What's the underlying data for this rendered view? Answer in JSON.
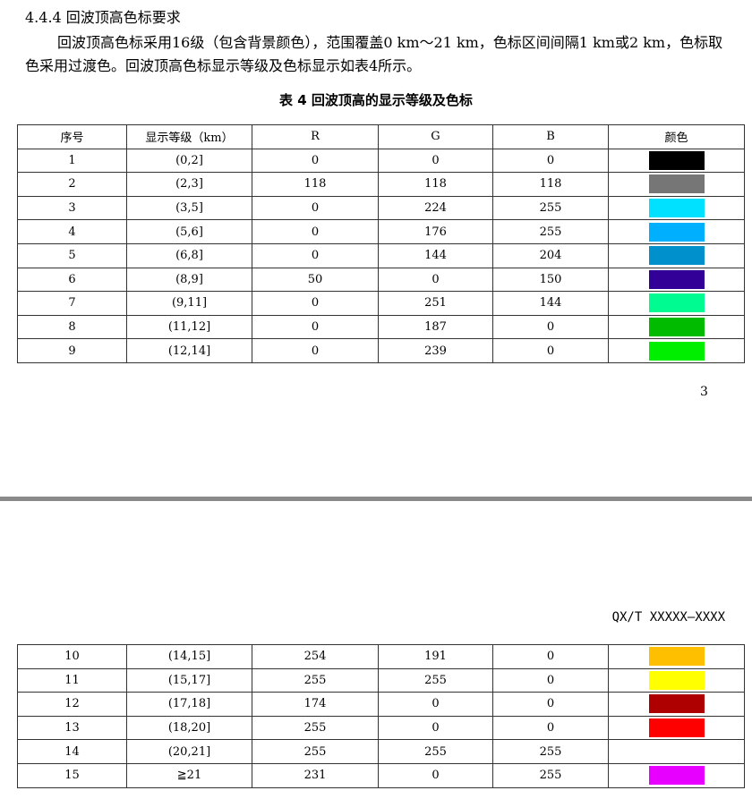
{
  "heading": "4.4.4  回波顶高色标要求",
  "paragraph": "回波顶高色标采用16级（包含背景颜色），范围覆盖0 km～21 km，色标区间间隔1 km或2 km，色标取色采用过渡色。回波顶高色标显示等级及色标显示如表4所示。",
  "table_caption": "表 4 回波顶高的显示等级及色标",
  "headers": [
    "序号",
    "显示等级（km）",
    "R",
    "G",
    "B",
    "颜色"
  ],
  "rows_page1": [
    {
      "no": "1",
      "level": "(0,2]",
      "r": "0",
      "g": "0",
      "b": "0",
      "color": "#000000"
    },
    {
      "no": "2",
      "level": "(2,3]",
      "r": "118",
      "g": "118",
      "b": "118",
      "color": "#767676"
    },
    {
      "no": "3",
      "level": "(3,5]",
      "r": "0",
      "g": "224",
      "b": "255",
      "color": "#00e0ff"
    },
    {
      "no": "4",
      "level": "(5,6]",
      "r": "0",
      "g": "176",
      "b": "255",
      "color": "#00b0ff"
    },
    {
      "no": "5",
      "level": "(6,8]",
      "r": "0",
      "g": "144",
      "b": "204",
      "color": "#0090cc"
    },
    {
      "no": "6",
      "level": "(8,9]",
      "r": "50",
      "g": "0",
      "b": "150",
      "color": "#320096"
    },
    {
      "no": "7",
      "level": "(9,11]",
      "r": "0",
      "g": "251",
      "b": "144",
      "color": "#00fb90"
    },
    {
      "no": "8",
      "level": "(11,12]",
      "r": "0",
      "g": "187",
      "b": "0",
      "color": "#00bb00"
    },
    {
      "no": "9",
      "level": "(12,14]",
      "r": "0",
      "g": "239",
      "b": "0",
      "color": "#00ef00"
    }
  ],
  "page_number": "3",
  "standard_code": "QX/T XXXXX—XXXX",
  "rows_page2": [
    {
      "no": "10",
      "level": "(14,15]",
      "r": "254",
      "g": "191",
      "b": "0",
      "color": "#febf00"
    },
    {
      "no": "11",
      "level": "(15,17]",
      "r": "255",
      "g": "255",
      "b": "0",
      "color": "#ffff00"
    },
    {
      "no": "12",
      "level": "(17,18]",
      "r": "174",
      "g": "0",
      "b": "0",
      "color": "#ae0000"
    },
    {
      "no": "13",
      "level": "(18,20]",
      "r": "255",
      "g": "0",
      "b": "0",
      "color": "#ff0000"
    },
    {
      "no": "14",
      "level": "(20,21]",
      "r": "255",
      "g": "255",
      "b": "255",
      "color": "#ffffff"
    },
    {
      "no": "15",
      "level": "≧21",
      "r": "231",
      "g": "0",
      "b": "255",
      "color": "#e700ff"
    }
  ]
}
